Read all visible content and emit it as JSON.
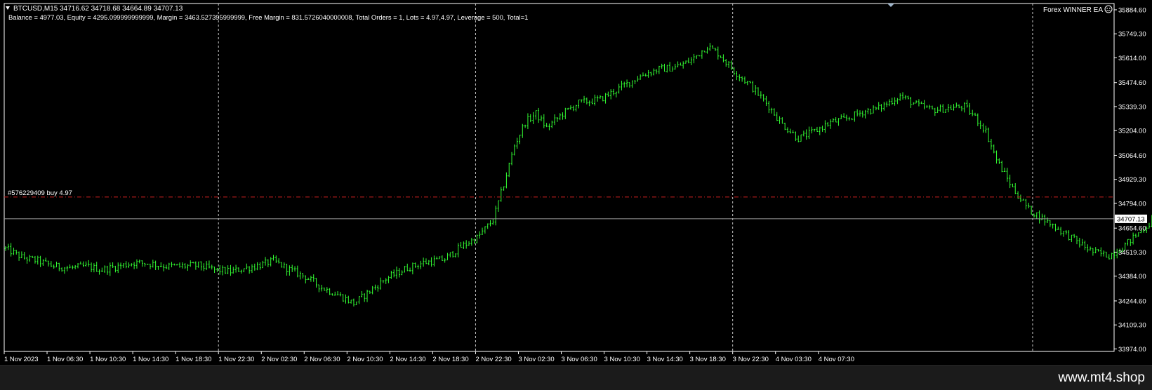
{
  "header": {
    "symbol_line": "BTCUSD,M15  34716.62 34718.68 34664.89 34707.13",
    "account_line": "Balance = 4977.03, Equity = 4295.099999999999, Margin = 3463.527395999999, Free Margin = 831.5726040000008, Total Orders = 1, Lots = 4.97,4.97, Leverage = 500, Total=1",
    "ea_label": "Forex WINNER EA",
    "ea_icon": "smiley-icon"
  },
  "footer": {
    "site": "www.mt4.shop"
  },
  "colors": {
    "background": "#000000",
    "candle": "#33ff33",
    "order_line": "#cc2222",
    "bid_line": "#9a9a9a",
    "grid": "#c8c8c8",
    "axis": "#ffffff"
  },
  "chart_data": {
    "type": "candlestick",
    "symbol": "BTCUSD",
    "timeframe": "M15",
    "ohlc_last": {
      "open": 34716.62,
      "high": 34718.68,
      "low": 34664.89,
      "close": 34707.13
    },
    "current_price": 34707.13,
    "current_price_label": "34707.13",
    "ylim": [
      33960,
      35920
    ],
    "y_ticks": [
      35884.6,
      35749.3,
      35614.0,
      35474.6,
      35339.3,
      35204.0,
      35064.6,
      34929.3,
      34794.0,
      34654.6,
      34519.3,
      34384.0,
      34244.6,
      34109.3,
      33974.0
    ],
    "y_tick_labels": [
      "35884.60",
      "35749.30",
      "35614.00",
      "35474.60",
      "35339.30",
      "35204.00",
      "35064.60",
      "34929.30",
      "34794.00",
      "34654.60",
      "34519.30",
      "34384.00",
      "34244.60",
      "34109.30",
      "33974.00"
    ],
    "x_labels": [
      "1 Nov 2023",
      "1 Nov 06:30",
      "1 Nov 10:30",
      "1 Nov 14:30",
      "1 Nov 18:30",
      "1 Nov 22:30",
      "2 Nov 02:30",
      "2 Nov 06:30",
      "2 Nov 10:30",
      "2 Nov 14:30",
      "2 Nov 18:30",
      "2 Nov 22:30",
      "3 Nov 02:30",
      "3 Nov 06:30",
      "3 Nov 10:30",
      "3 Nov 14:30",
      "3 Nov 18:30",
      "3 Nov 22:30",
      "4 Nov 03:30",
      "4 Nov 07:30"
    ],
    "bars_per_label": 16,
    "day_separators_after_label": [
      5,
      11,
      17
    ],
    "order": {
      "label": "#576229409 buy 4.97",
      "ticket": "576229409",
      "side": "buy",
      "lots": 4.97,
      "price": 34830
    },
    "price_path": [
      [
        0,
        34540
      ],
      [
        6,
        34490
      ],
      [
        12,
        34470
      ],
      [
        18,
        34440
      ],
      [
        24,
        34430
      ],
      [
        30,
        34440
      ],
      [
        36,
        34420
      ],
      [
        42,
        34440
      ],
      [
        48,
        34460
      ],
      [
        54,
        34455
      ],
      [
        60,
        34440
      ],
      [
        66,
        34440
      ],
      [
        72,
        34445
      ],
      [
        78,
        34420
      ],
      [
        84,
        34410
      ],
      [
        90,
        34430
      ],
      [
        96,
        34450
      ],
      [
        100,
        34470
      ],
      [
        106,
        34420
      ],
      [
        112,
        34380
      ],
      [
        118,
        34320
      ],
      [
        124,
        34280
      ],
      [
        130,
        34230
      ],
      [
        136,
        34300
      ],
      [
        142,
        34370
      ],
      [
        150,
        34430
      ],
      [
        156,
        34460
      ],
      [
        164,
        34480
      ],
      [
        170,
        34550
      ],
      [
        176,
        34600
      ],
      [
        182,
        34700
      ],
      [
        186,
        34900
      ],
      [
        190,
        35120
      ],
      [
        194,
        35250
      ],
      [
        198,
        35300
      ],
      [
        202,
        35220
      ],
      [
        208,
        35300
      ],
      [
        214,
        35360
      ],
      [
        222,
        35380
      ],
      [
        230,
        35450
      ],
      [
        238,
        35520
      ],
      [
        244,
        35550
      ],
      [
        250,
        35560
      ],
      [
        256,
        35600
      ],
      [
        262,
        35680
      ],
      [
        266,
        35640
      ],
      [
        272,
        35540
      ],
      [
        278,
        35460
      ],
      [
        284,
        35360
      ],
      [
        290,
        35240
      ],
      [
        296,
        35160
      ],
      [
        302,
        35200
      ],
      [
        308,
        35250
      ],
      [
        314,
        35270
      ],
      [
        320,
        35310
      ],
      [
        326,
        35330
      ],
      [
        334,
        35400
      ],
      [
        340,
        35350
      ],
      [
        346,
        35320
      ],
      [
        352,
        35330
      ],
      [
        358,
        35340
      ],
      [
        362,
        35280
      ],
      [
        366,
        35200
      ],
      [
        370,
        35040
      ],
      [
        376,
        34880
      ],
      [
        382,
        34760
      ],
      [
        388,
        34700
      ],
      [
        394,
        34640
      ],
      [
        400,
        34580
      ],
      [
        406,
        34520
      ],
      [
        412,
        34500
      ],
      [
        418,
        34560
      ],
      [
        424,
        34640
      ],
      [
        430,
        34720
      ],
      [
        436,
        34780
      ],
      [
        442,
        34830
      ],
      [
        448,
        34870
      ],
      [
        452,
        34930
      ],
      [
        456,
        34900
      ],
      [
        462,
        34850
      ],
      [
        468,
        34840
      ],
      [
        474,
        34800
      ],
      [
        480,
        34760
      ],
      [
        486,
        34720
      ],
      [
        490,
        34790
      ],
      [
        494,
        34780
      ],
      [
        500,
        34700
      ],
      [
        506,
        34600
      ],
      [
        512,
        34500
      ],
      [
        518,
        34540
      ],
      [
        524,
        34600
      ],
      [
        530,
        34620
      ],
      [
        536,
        34640
      ],
      [
        542,
        34620
      ],
      [
        546,
        34560
      ],
      [
        550,
        34520
      ],
      [
        556,
        34460
      ],
      [
        562,
        34400
      ],
      [
        568,
        34440
      ],
      [
        574,
        34480
      ],
      [
        580,
        34460
      ],
      [
        586,
        34460
      ],
      [
        592,
        34440
      ],
      [
        598,
        34380
      ],
      [
        604,
        34300
      ],
      [
        610,
        34230
      ],
      [
        616,
        34140
      ],
      [
        622,
        34100
      ],
      [
        628,
        34120
      ],
      [
        634,
        34140
      ],
      [
        640,
        34160
      ],
      [
        646,
        34200
      ],
      [
        652,
        34280
      ],
      [
        656,
        34400
      ],
      [
        662,
        34540
      ],
      [
        668,
        34640
      ],
      [
        674,
        34730
      ],
      [
        680,
        34760
      ],
      [
        686,
        34720
      ],
      [
        692,
        34640
      ],
      [
        696,
        34560
      ],
      [
        700,
        34450
      ],
      [
        704,
        34320
      ],
      [
        708,
        34380
      ],
      [
        714,
        34460
      ],
      [
        720,
        34500
      ],
      [
        726,
        34520
      ],
      [
        732,
        34530
      ],
      [
        738,
        34550
      ],
      [
        744,
        34560
      ],
      [
        750,
        34580
      ],
      [
        756,
        34600
      ],
      [
        762,
        34630
      ],
      [
        768,
        34640
      ],
      [
        774,
        34660
      ],
      [
        780,
        34680
      ],
      [
        786,
        34660
      ],
      [
        792,
        34620
      ],
      [
        798,
        34610
      ],
      [
        804,
        34640
      ],
      [
        810,
        34620
      ],
      [
        816,
        34580
      ],
      [
        822,
        34560
      ],
      [
        826,
        34600
      ],
      [
        830,
        34640
      ],
      [
        834,
        34830
      ],
      [
        838,
        34780
      ],
      [
        842,
        34730
      ],
      [
        846,
        34770
      ],
      [
        850,
        34780
      ],
      [
        854,
        34740
      ],
      [
        856,
        34707
      ]
    ],
    "x_total_bars": 1040
  }
}
